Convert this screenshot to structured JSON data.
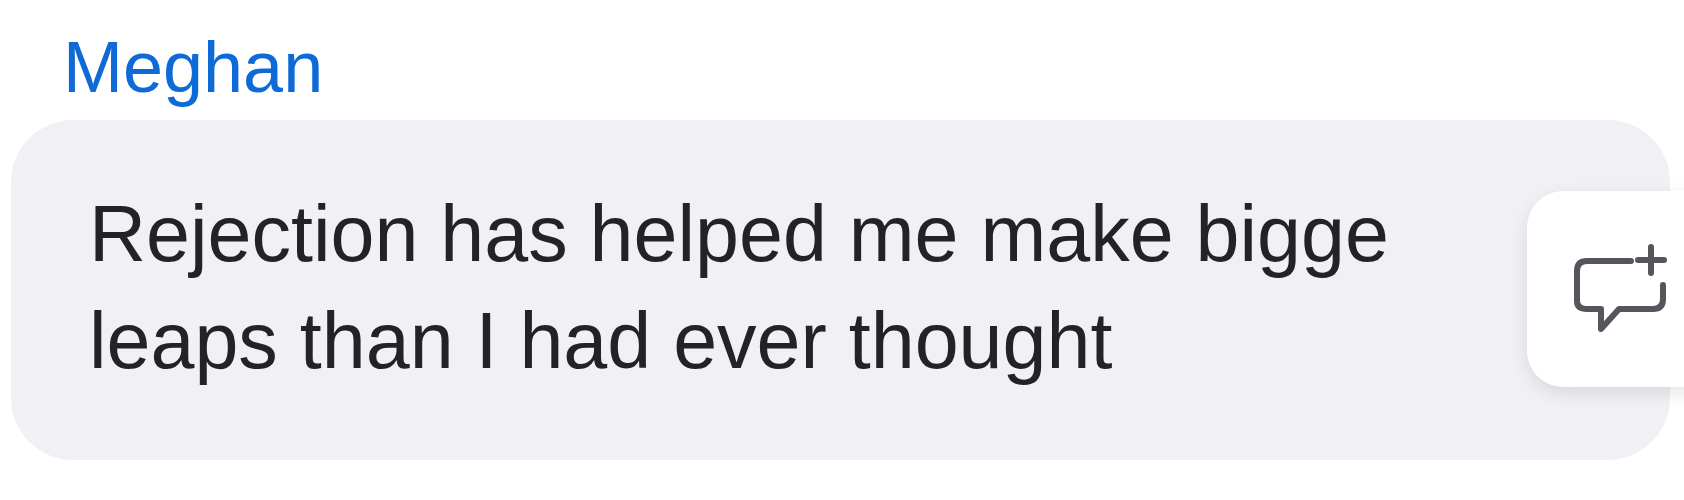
{
  "message": {
    "sender": "Meghan",
    "text": "Rejection has helped me make bigge leaps than I had ever thought"
  },
  "action_card": {
    "kind": "add-reaction"
  }
}
